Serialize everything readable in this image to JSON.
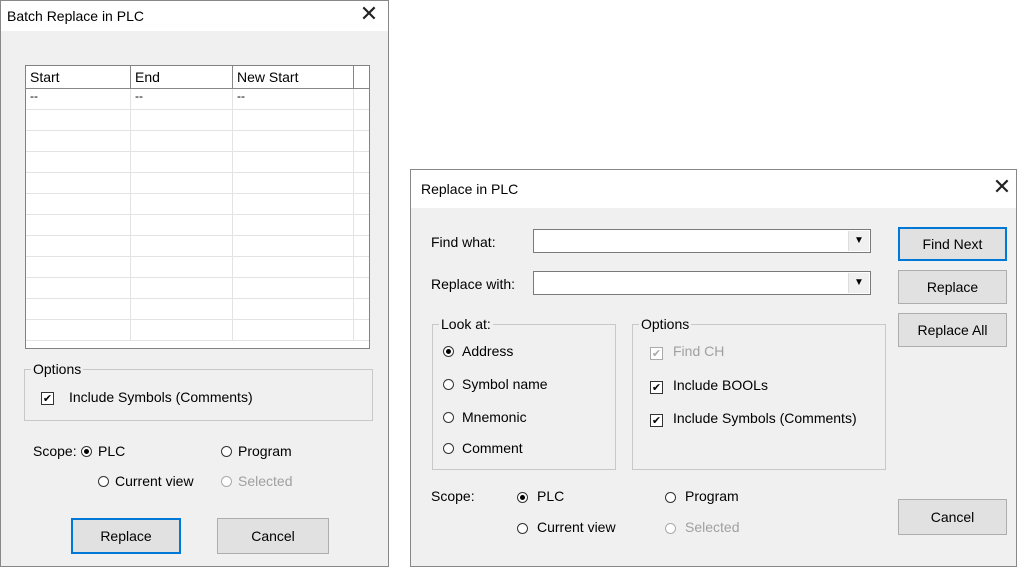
{
  "batch": {
    "title": "Batch Replace in PLC",
    "table": {
      "headers": [
        "Start",
        "End",
        "New Start"
      ],
      "rows": [
        [
          "--",
          "--",
          "--"
        ],
        [
          "",
          "",
          ""
        ],
        [
          "",
          "",
          ""
        ],
        [
          "",
          "",
          ""
        ],
        [
          "",
          "",
          ""
        ],
        [
          "",
          "",
          ""
        ],
        [
          "",
          "",
          ""
        ],
        [
          "",
          "",
          ""
        ],
        [
          "",
          "",
          ""
        ],
        [
          "",
          "",
          ""
        ],
        [
          "",
          "",
          ""
        ],
        [
          "",
          "",
          ""
        ]
      ]
    },
    "options": {
      "label": "Options",
      "include_symbols": "Include Symbols (Comments)",
      "include_symbols_checked": true
    },
    "scope": {
      "label": "Scope:",
      "plc": "PLC",
      "program": "Program",
      "current_view": "Current view",
      "selected": "Selected",
      "value": "PLC"
    },
    "replace_label": "Replace",
    "cancel_label": "Cancel"
  },
  "replace": {
    "title": "Replace in PLC",
    "find_what": {
      "label": "Find what:",
      "value": ""
    },
    "replace_with": {
      "label": "Replace with:",
      "value": ""
    },
    "look_at": {
      "label": "Look at:",
      "address": "Address",
      "symbol_name": "Symbol name",
      "mnemonic": "Mnemonic",
      "comment": "Comment",
      "value": "Address"
    },
    "options": {
      "label": "Options",
      "find_ch": "Find CH",
      "include_bools": "Include BOOLs",
      "include_symbols": "Include Symbols (Comments)"
    },
    "scope": {
      "label": "Scope:",
      "plc": "PLC",
      "program": "Program",
      "current_view": "Current view",
      "selected": "Selected",
      "value": "PLC"
    },
    "buttons": {
      "find_next": "Find Next",
      "replace": "Replace",
      "replace_all": "Replace All",
      "cancel": "Cancel"
    }
  }
}
